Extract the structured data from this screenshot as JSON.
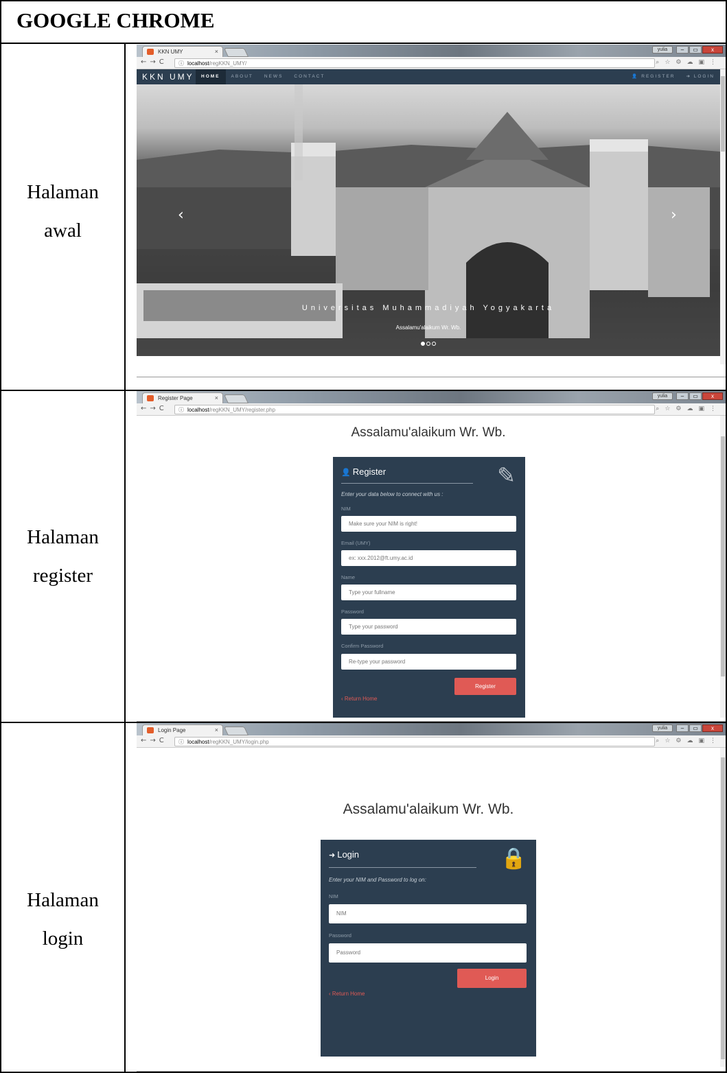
{
  "document": {
    "title": "GOOGLE CHROME",
    "rows": [
      {
        "label_line1": "Halaman",
        "label_line2": "awal"
      },
      {
        "label_line1": "Halaman",
        "label_line2": "register"
      },
      {
        "label_line1": "Halaman",
        "label_line2": "login"
      }
    ]
  },
  "window": {
    "user_badge": "yulia",
    "min": "–",
    "max": "▭",
    "close": "x"
  },
  "landing": {
    "tab_title": "KKN UMY",
    "url_host": "localhost",
    "url_path": "/regKKN_UMY/",
    "brand": "KKN UMY",
    "nav": [
      "HOME",
      "ABOUT",
      "NEWS",
      "CONTACT"
    ],
    "register": "REGISTER",
    "login": "LOGIN",
    "caption": "Universitas Muhammadiyah Yogyakarta",
    "subcaption": "Assalamu'alaikum Wr. Wb.",
    "prev_icon": "‹",
    "next_icon": "›"
  },
  "register_page": {
    "tab_title": "Register Page",
    "url_host": "localhost",
    "url_path": "/regKKN_UMY/register.php",
    "greeting": "Assalamu'alaikum Wr. Wb.",
    "card_title": "Register",
    "intro": "Enter your data below to connect with us :",
    "fields": [
      {
        "label": "NIM",
        "placeholder": "Make sure your NIM is right!"
      },
      {
        "label": "Email (UMY)",
        "placeholder": "ex: xxx.2012@ft.umy.ac.id"
      },
      {
        "label": "Name",
        "placeholder": "Type your fullname"
      },
      {
        "label": "Password",
        "placeholder": "Type your password"
      },
      {
        "label": "Confirm Password",
        "placeholder": "Re-type your password"
      }
    ],
    "submit": "Register",
    "return_home": "Return Home"
  },
  "login_page": {
    "tab_title": "Login Page",
    "url_host": "localhost",
    "url_path": "/regKKN_UMY/login.php",
    "greeting": "Assalamu'alaikum Wr. Wb.",
    "card_title": "Login",
    "intro": "Enter your NIM and Password to log on:",
    "fields": [
      {
        "label": "NIM",
        "placeholder": "NIM"
      },
      {
        "label": "Password",
        "placeholder": "Password"
      }
    ],
    "submit": "Login",
    "return_home": "Return Home"
  },
  "colors": {
    "navbar": "#2c3e50",
    "accent": "#e05a55",
    "card": "#2c3e50"
  }
}
